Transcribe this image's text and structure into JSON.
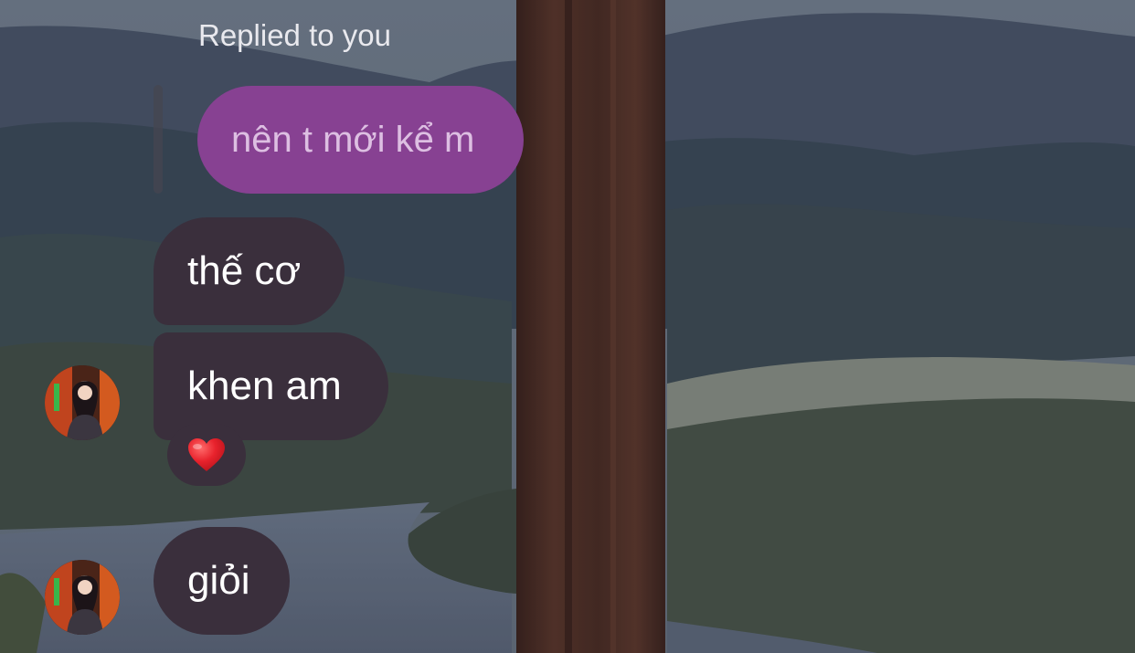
{
  "reply": {
    "label": "Replied to you",
    "quoted_text": "nên t mới kể m"
  },
  "messages": [
    {
      "text": "thế cơ"
    },
    {
      "text": "khen am",
      "reaction": "heart"
    },
    {
      "text": "giỏi"
    }
  ],
  "colors": {
    "reply_bubble": "#874192",
    "incoming_bubble": "#3a2f3c",
    "reaction_heart": "#e8222c"
  },
  "icons": [
    "heart-reaction-icon",
    "avatar-icon"
  ]
}
